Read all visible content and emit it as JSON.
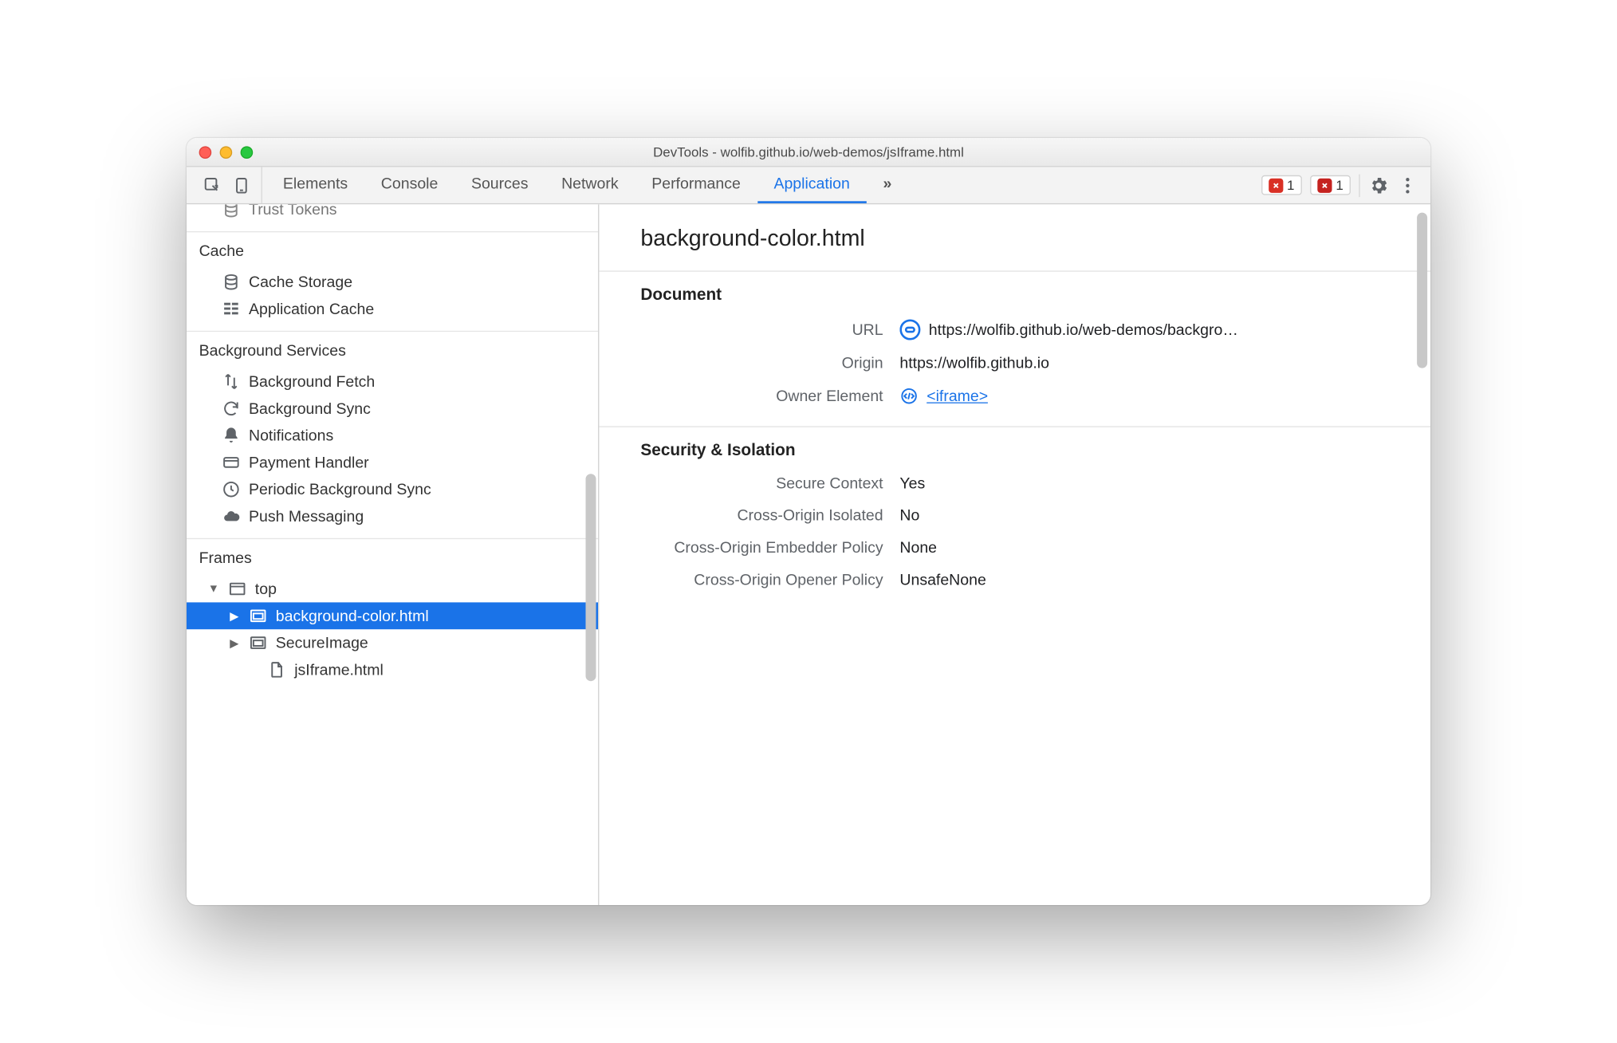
{
  "window": {
    "title": "DevTools - wolfib.github.io/web-demos/jsIframe.html"
  },
  "toolbar": {
    "tabs": [
      "Elements",
      "Console",
      "Sources",
      "Network",
      "Performance",
      "Application"
    ],
    "more_glyph": "»",
    "active_index": 5,
    "error_count": "1",
    "error2_count": "1"
  },
  "sidebar": {
    "partial_item": "Trust Tokens",
    "groups": [
      {
        "title": "Cache",
        "items": [
          {
            "icon": "db",
            "label": "Cache Storage"
          },
          {
            "icon": "grid",
            "label": "Application Cache"
          }
        ]
      },
      {
        "title": "Background Services",
        "items": [
          {
            "icon": "updown",
            "label": "Background Fetch"
          },
          {
            "icon": "sync",
            "label": "Background Sync"
          },
          {
            "icon": "bell",
            "label": "Notifications"
          },
          {
            "icon": "card",
            "label": "Payment Handler"
          },
          {
            "icon": "clock",
            "label": "Periodic Background Sync"
          },
          {
            "icon": "cloud",
            "label": "Push Messaging"
          }
        ]
      }
    ],
    "frames": {
      "title": "Frames",
      "top_label": "top",
      "children": [
        {
          "label": "background-color.html",
          "selected": true,
          "has_children": true
        },
        {
          "label": "SecureImage",
          "selected": false,
          "has_children": true
        },
        {
          "label": "jsIframe.html",
          "selected": false,
          "has_children": false,
          "icon": "file"
        }
      ]
    }
  },
  "main": {
    "title": "background-color.html",
    "sections": [
      {
        "heading": "Document",
        "rows": [
          {
            "k": "URL",
            "v": "https://wolfib.github.io/web-demos/backgro…",
            "pill": true
          },
          {
            "k": "Origin",
            "v": "https://wolfib.github.io"
          },
          {
            "k": "Owner Element",
            "v": "<iframe>",
            "link": true,
            "codeic": true
          }
        ]
      },
      {
        "heading": "Security & Isolation",
        "rows": [
          {
            "k": "Secure Context",
            "v": "Yes"
          },
          {
            "k": "Cross-Origin Isolated",
            "v": "No"
          },
          {
            "k": "Cross-Origin Embedder Policy",
            "v": "None"
          },
          {
            "k": "Cross-Origin Opener Policy",
            "v": "UnsafeNone"
          }
        ]
      }
    ]
  }
}
